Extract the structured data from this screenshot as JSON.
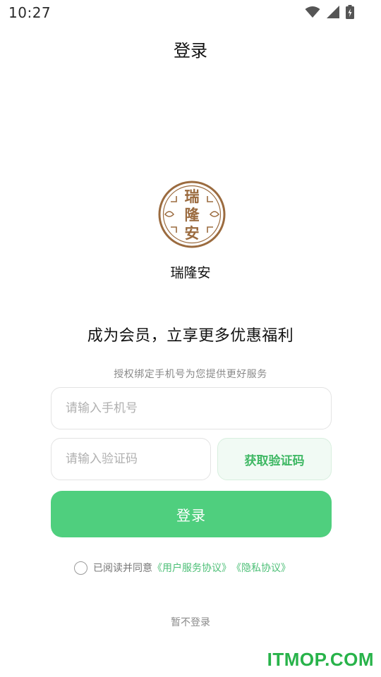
{
  "status_bar": {
    "time": "10:27",
    "icons": [
      "wifi-icon",
      "signal-icon",
      "battery-charging-icon"
    ]
  },
  "header": {
    "title": "登录"
  },
  "brand": {
    "logo_chars": [
      "瑞",
      "隆",
      "安"
    ],
    "name": "瑞隆安",
    "logo_color": "#9b6b3f"
  },
  "intro": {
    "headline": "成为会员，立享更多优惠福利",
    "subhead": "授权绑定手机号为您提供更好服务"
  },
  "form": {
    "phone_placeholder": "请输入手机号",
    "code_placeholder": "请输入验证码",
    "get_code_label": "获取验证码",
    "login_label": "登录"
  },
  "agreement": {
    "text": "已阅读并同意",
    "user_agreement": "《用户服务协议》",
    "privacy_policy": "《隐私协议》",
    "checked": false
  },
  "skip_label": "暂不登录",
  "watermark": "ITMOP.COM",
  "colors": {
    "accent": "#4fcf7e",
    "link": "#4cbf76",
    "brand": "#9b6b3f"
  }
}
